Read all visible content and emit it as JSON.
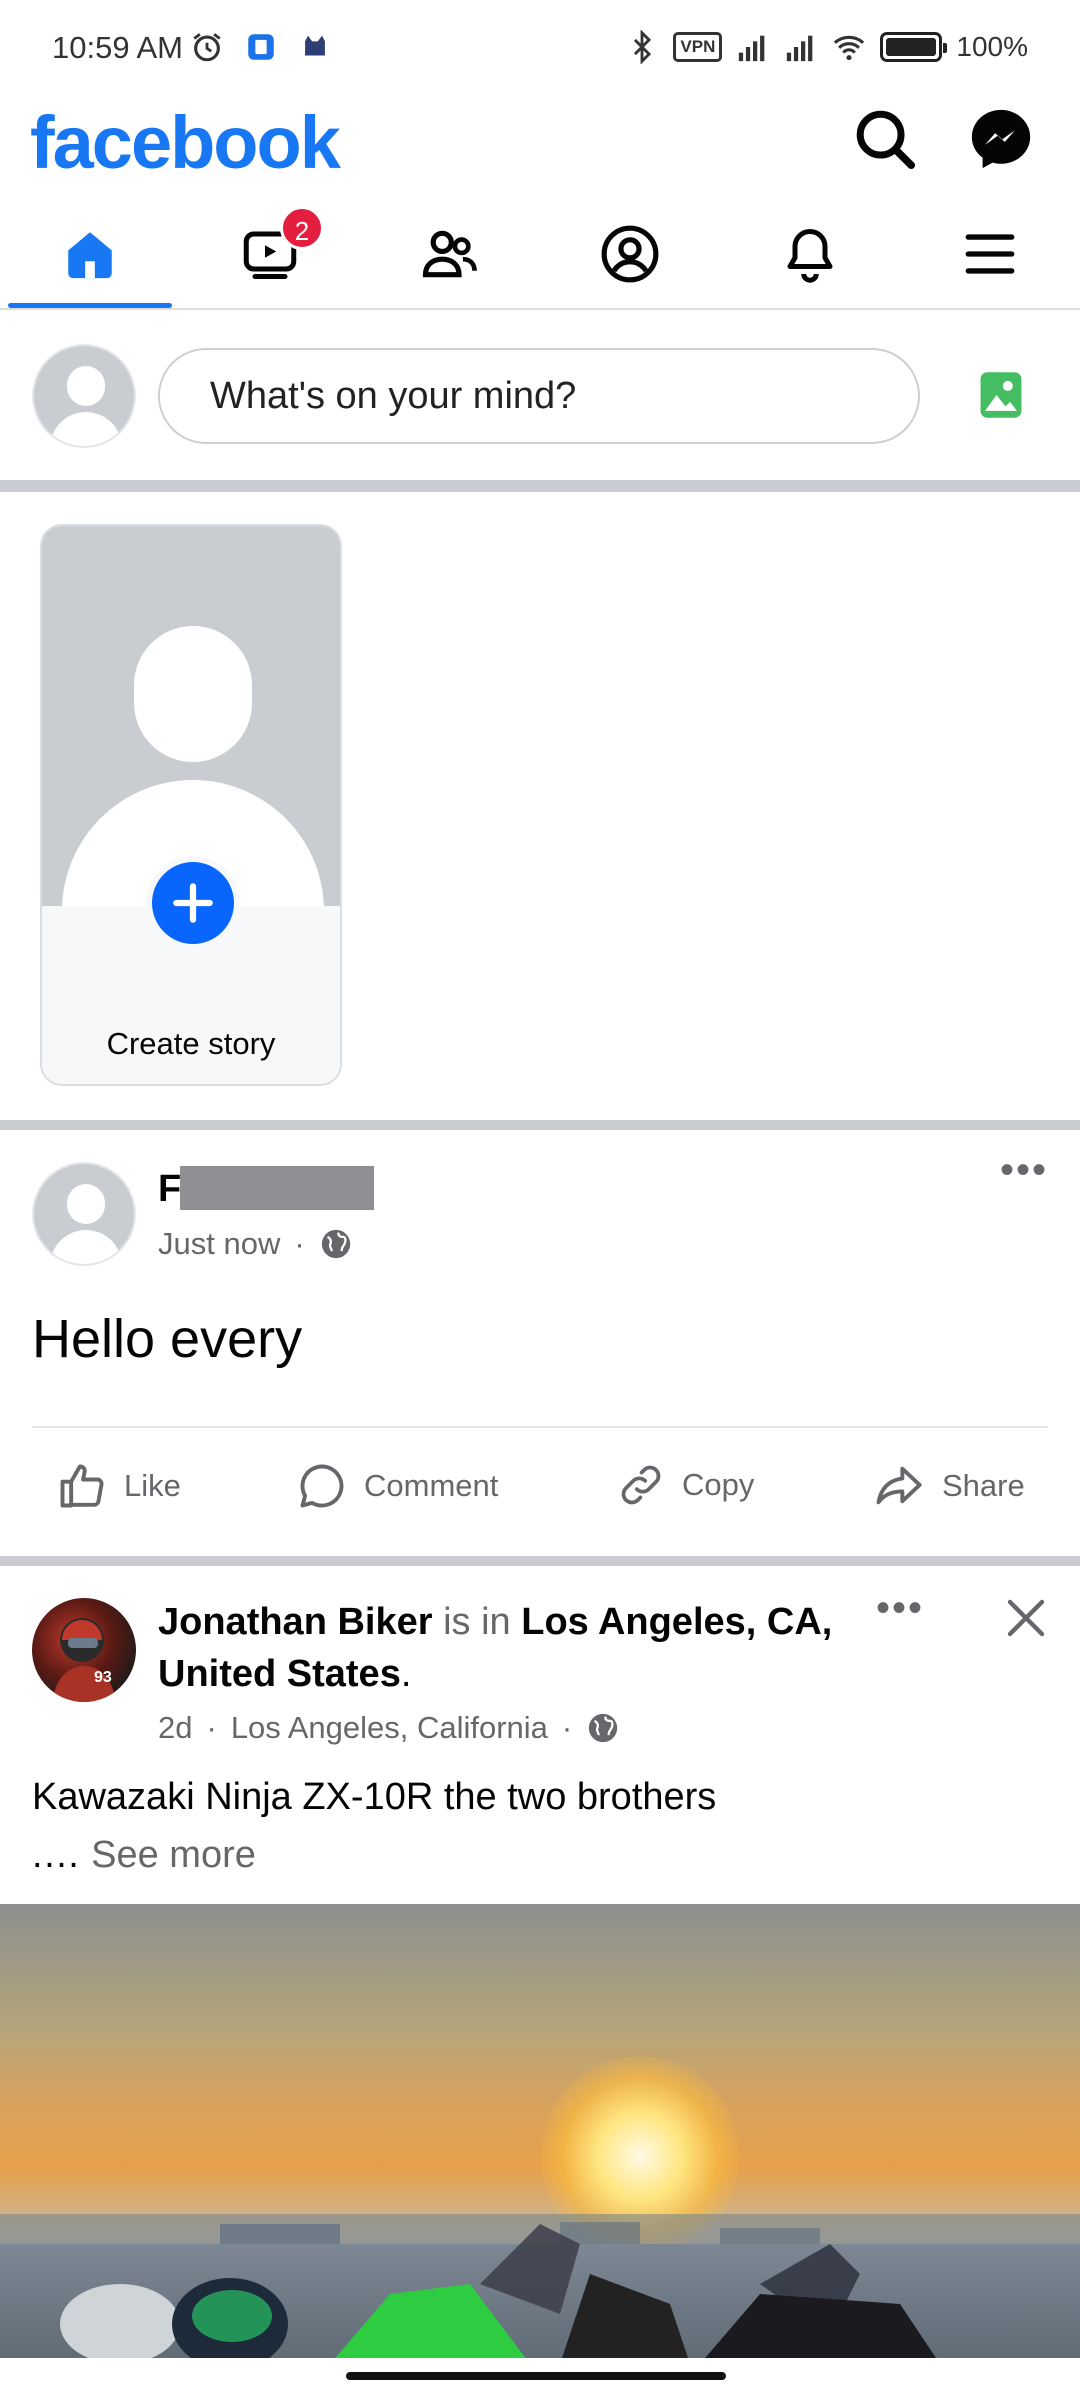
{
  "status_bar": {
    "time": "10:59 AM",
    "battery": "100%",
    "vpn": "VPN",
    "icons": [
      "alarm-icon",
      "app-notification-icon",
      "cat-icon",
      "bluetooth-icon",
      "signal-icon",
      "wifi-icon",
      "battery-icon"
    ]
  },
  "header": {
    "logo": "facebook",
    "brand_color": "#1877f2",
    "icons": [
      "search-icon",
      "messenger-icon"
    ]
  },
  "nav": {
    "tabs": [
      {
        "name": "home",
        "icon": "home-icon",
        "active": true
      },
      {
        "name": "video",
        "icon": "video-icon",
        "badge": "2"
      },
      {
        "name": "friends",
        "icon": "friends-icon"
      },
      {
        "name": "profile",
        "icon": "profile-icon"
      },
      {
        "name": "notifications",
        "icon": "bell-icon"
      },
      {
        "name": "menu",
        "icon": "menu-icon"
      }
    ]
  },
  "composer": {
    "placeholder": "What's on your mind?",
    "photo_icon": "photo-icon"
  },
  "stories": {
    "create_label": "Create story"
  },
  "post1": {
    "author_initial": "F",
    "time": "Just now",
    "separator": "·",
    "audience_icon": "globe-icon",
    "text": "Hello every",
    "actions": {
      "like": "Like",
      "comment": "Comment",
      "copy": "Copy",
      "share": "Share"
    }
  },
  "post2": {
    "author": "Jonathan Biker",
    "is_in": "is in",
    "location": "Los Angeles, CA, United States",
    "period": ".",
    "time": "2d",
    "sep": "·",
    "place": "Los Angeles, California",
    "text": "Kawazaki Ninja ZX-10R the two brothers",
    "ellipsis": ".…",
    "see_more": "See more"
  }
}
